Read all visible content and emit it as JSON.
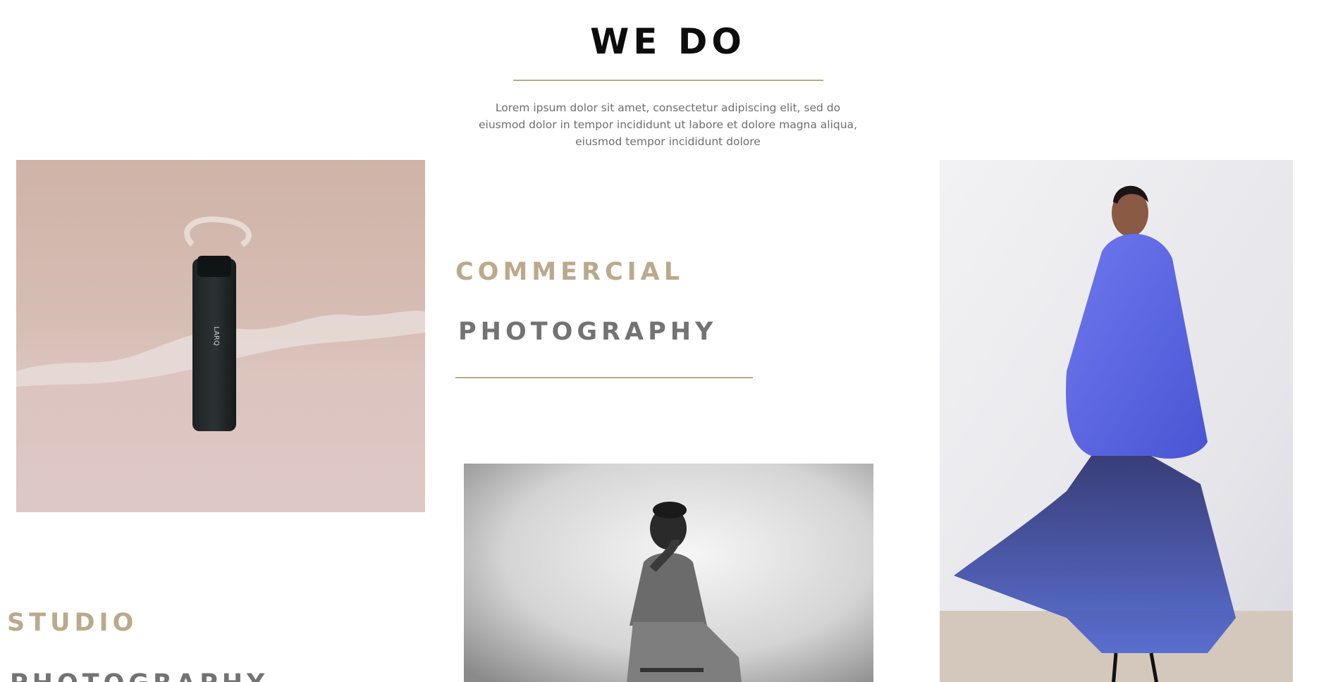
{
  "section": {
    "title": "WE DO",
    "intro": "Lorem ipsum dolor sit amet, consectetur adipiscing elit, sed do eiusmod dolor in tempor incididunt ut labore et dolore magna aliqua, eiusmod tempor incididunt dolore"
  },
  "services": [
    {
      "line1": "COMMERCIAL",
      "line2": "PHOTOGRAPHY"
    },
    {
      "line1": "STUDIO",
      "line2": "PHOTOGRAPHY"
    }
  ],
  "photos": {
    "bottle_label": "LARQ"
  },
  "colors": {
    "accent": "#bba98b",
    "heading_dark": "#0d0d0d",
    "heading_grey": "#737373",
    "body_text": "#6e6e6e",
    "sand": "#d9c2bc",
    "coat_blue": "#5a63e0"
  }
}
